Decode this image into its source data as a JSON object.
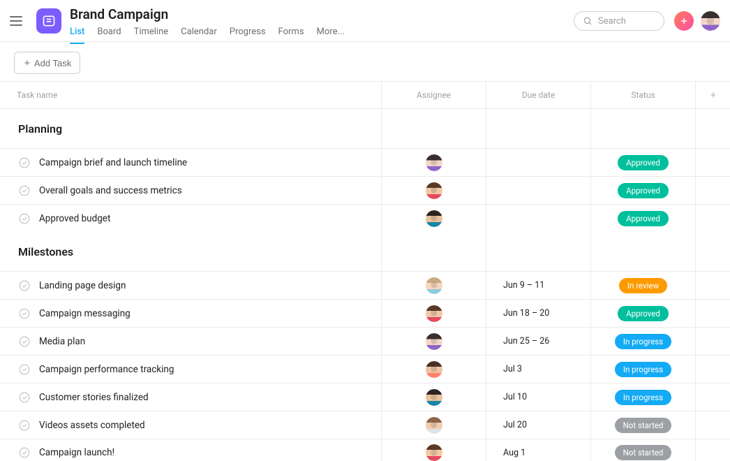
{
  "header": {
    "title": "Brand Campaign",
    "tabs": [
      "List",
      "Board",
      "Timeline",
      "Calendar",
      "Progress",
      "Forms",
      "More..."
    ],
    "active_tab": 0,
    "search_placeholder": "Search"
  },
  "toolbar": {
    "add_task_label": "Add Task"
  },
  "columns": {
    "name": "Task name",
    "assignee": "Assignee",
    "due": "Due date",
    "status": "Status"
  },
  "avatars": {
    "a1": "av1",
    "a2": "av2",
    "a3": "av3",
    "a4": "av4",
    "a5": "av5",
    "a6": "av6",
    "top": "av1"
  },
  "status_styles": {
    "Approved": "status-approved",
    "In review": "status-in-review",
    "In progress": "status-in-progress",
    "Not started": "status-not-started"
  },
  "sections": [
    {
      "name": "Planning",
      "tasks": [
        {
          "name": "Campaign brief and launch timeline",
          "assignee": "a1",
          "due": "",
          "status": "Approved"
        },
        {
          "name": "Overall goals and success metrics",
          "assignee": "a2",
          "due": "",
          "status": "Approved"
        },
        {
          "name": "Approved budget",
          "assignee": "a3",
          "due": "",
          "status": "Approved"
        }
      ]
    },
    {
      "name": "Milestones",
      "tasks": [
        {
          "name": "Landing page design",
          "assignee": "a4",
          "due": "Jun 9 – 11",
          "status": "In review"
        },
        {
          "name": "Campaign messaging",
          "assignee": "a2",
          "due": "Jun 18 – 20",
          "status": "Approved"
        },
        {
          "name": "Media plan",
          "assignee": "a1",
          "due": "Jun 25 – 26",
          "status": "In progress"
        },
        {
          "name": "Campaign performance tracking",
          "assignee": "a5",
          "due": "Jul 3",
          "status": "In progress"
        },
        {
          "name": "Customer stories finalized",
          "assignee": "a3",
          "due": "Jul 10",
          "status": "In progress"
        },
        {
          "name": "Videos assets completed",
          "assignee": "a6",
          "due": "Jul 20",
          "status": "Not started"
        },
        {
          "name": "Campaign launch!",
          "assignee": "a2",
          "due": "Aug 1",
          "status": "Not started"
        }
      ]
    }
  ]
}
